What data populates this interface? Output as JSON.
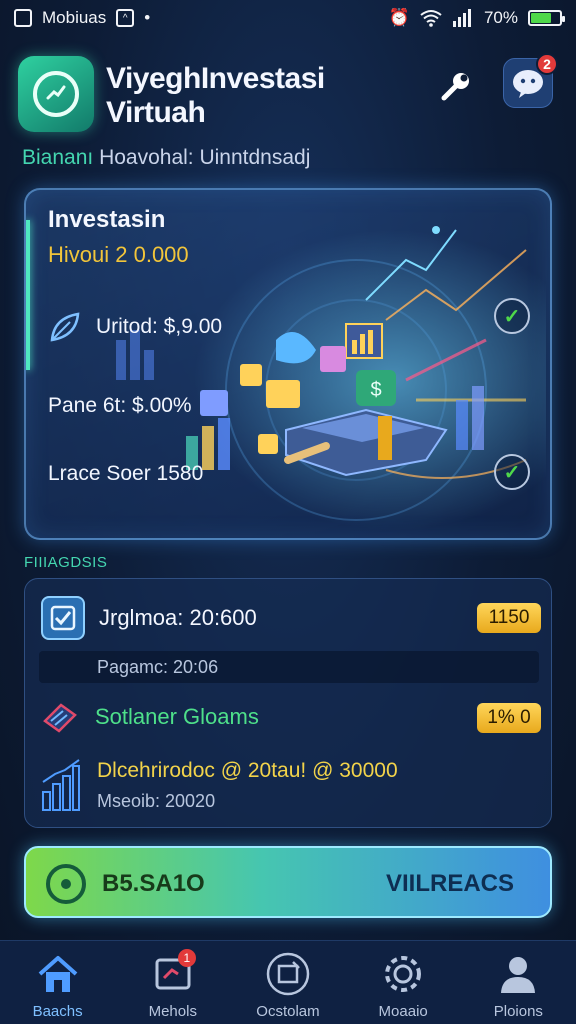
{
  "status_bar": {
    "carrier": "Mobiuas",
    "battery": "70%",
    "battery_level": 0.7
  },
  "header": {
    "app_title": "ViyeghInvestasi Virtuah",
    "notification_count": "2"
  },
  "subtitle": {
    "label": "Biananı",
    "value": "Hoavohal: Uinntdnsadj"
  },
  "hero": {
    "title": "Investasin",
    "amount": "Hivoui 2 0.000",
    "rows": [
      {
        "text": "Uritod: $,9.00"
      },
      {
        "text": "Pane 6t: $.00%"
      },
      {
        "text": "Lrace Soer 1580"
      }
    ]
  },
  "list_section": {
    "label": "FIIIAGDSIS",
    "row1": {
      "text": "Jrglmoa: 20:600",
      "badge": "1150"
    },
    "row1_sub": "Pagamc: 20:06",
    "row2": {
      "text": "Sotlaner Gloams",
      "badge": "1% 0"
    },
    "row3": {
      "main": "Dlcehrirodoc @ 20tau! @ 30000",
      "sub": "Mseoib: 20020"
    }
  },
  "wallet": {
    "amount": "B5.SA1O",
    "action": "VIILREACS"
  },
  "bottom_nav": {
    "items": [
      {
        "label": "Baachs"
      },
      {
        "label": "Mehols",
        "badge": "1"
      },
      {
        "label": "Ocstolam"
      },
      {
        "label": "Moaaio"
      },
      {
        "label": "Ploions"
      }
    ]
  },
  "colors": {
    "accent": "#44d6b0",
    "gold": "#f2c53a",
    "background": "#0d1c36",
    "success": "#4fd84a",
    "alert": "#e23a3a"
  }
}
